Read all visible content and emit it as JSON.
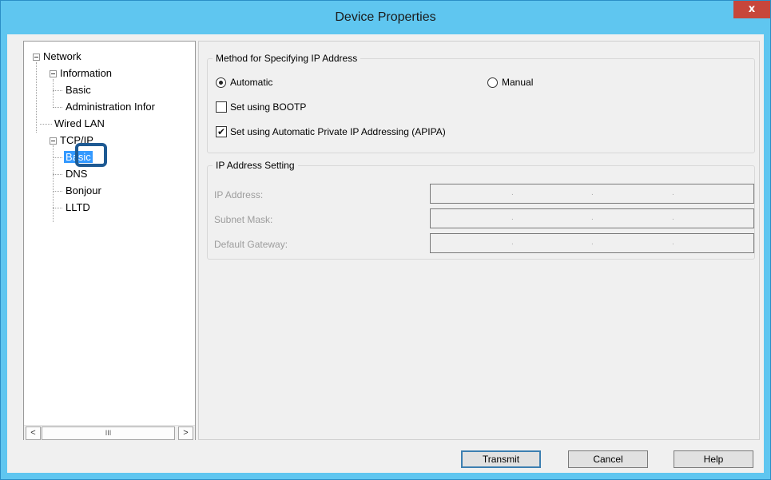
{
  "window": {
    "title": "Device Properties",
    "close_label": "x",
    "accent_color": "#5fc6f0"
  },
  "tree": {
    "items": [
      {
        "label": "Network",
        "level": 0,
        "expanded": true
      },
      {
        "label": "Information",
        "level": 1,
        "expanded": true
      },
      {
        "label": "Basic",
        "level": 2
      },
      {
        "label": "Administration Infor",
        "level": 2
      },
      {
        "label": "Wired LAN",
        "level": 1
      },
      {
        "label": "TCP/IP",
        "level": 1,
        "expanded": true
      },
      {
        "label": "Basic",
        "level": 2,
        "selected": true
      },
      {
        "label": "DNS",
        "level": 2
      },
      {
        "label": "Bonjour",
        "level": 2
      },
      {
        "label": "LLTD",
        "level": 2
      }
    ],
    "scroll_left": "<",
    "scroll_right": ">",
    "scroll_thumb": "III"
  },
  "method_group": {
    "title": "Method for Specifying IP Address",
    "automatic_label": "Automatic",
    "automatic_selected": true,
    "manual_label": "Manual",
    "manual_selected": false,
    "bootp_label": "Set using BOOTP",
    "bootp_checked": false,
    "apipa_label": "Set using Automatic Private IP Addressing (APIPA)",
    "apipa_checked": true
  },
  "ip_group": {
    "title": "IP Address Setting",
    "ip_label": "IP Address:",
    "subnet_label": "Subnet Mask:",
    "gateway_label": "Default Gateway:",
    "dot": "."
  },
  "buttons": {
    "transmit": "Transmit",
    "cancel": "Cancel",
    "help": "Help"
  }
}
